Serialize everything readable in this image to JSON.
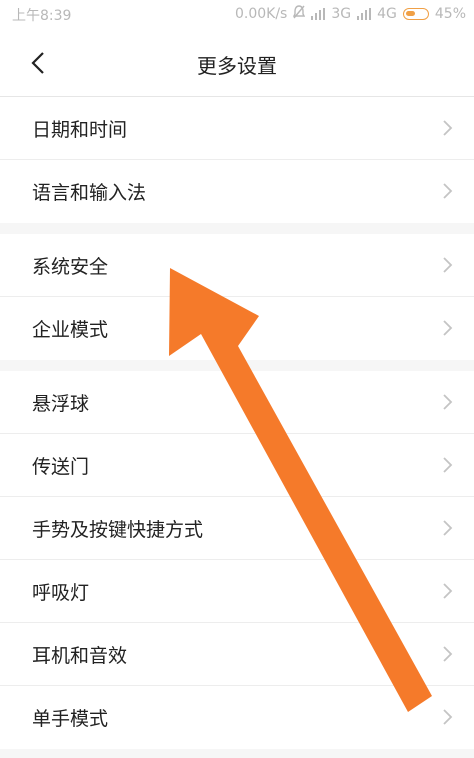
{
  "status_bar": {
    "time": "上午8:39",
    "speed": "0.00K/s",
    "net1": "3G",
    "net2": "4G",
    "battery": "45%",
    "battery_color": "#f0a046"
  },
  "nav": {
    "title": "更多设置",
    "back_icon": "chevron-left-icon"
  },
  "groups": [
    {
      "items": [
        {
          "label": "日期和时间"
        },
        {
          "label": "语言和输入法"
        }
      ]
    },
    {
      "items": [
        {
          "label": "系统安全"
        },
        {
          "label": "企业模式"
        }
      ]
    },
    {
      "items": [
        {
          "label": "悬浮球"
        },
        {
          "label": "传送门"
        },
        {
          "label": "手势及按键快捷方式"
        },
        {
          "label": "呼吸灯"
        },
        {
          "label": "耳机和音效"
        },
        {
          "label": "单手模式"
        }
      ]
    }
  ],
  "annotation": {
    "type": "arrow",
    "color": "#f57a2a",
    "points_to": "系统安全"
  }
}
